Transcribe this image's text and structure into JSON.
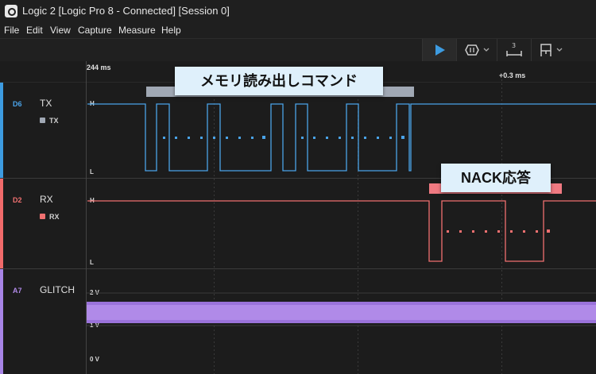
{
  "window": {
    "title": "Logic 2 [Logic Pro 8 - Connected] [Session 0]"
  },
  "menu": [
    "File",
    "Edit",
    "View",
    "Capture",
    "Measure",
    "Help"
  ],
  "ruler": {
    "start_label": "244 ms",
    "offset_label": "+0.3 ms"
  },
  "channels": {
    "tx": {
      "id": "D6",
      "name": "TX",
      "sublabel": "TX",
      "high": "H",
      "low": "L",
      "color": "#4aa3e8"
    },
    "rx": {
      "id": "D2",
      "name": "RX",
      "sublabel": "RX",
      "high": "H",
      "low": "L",
      "color": "#f07070"
    },
    "glitch": {
      "id": "A7",
      "name": "GLITCH",
      "v2": "2 V",
      "v1": "1 V",
      "v0": "0 V",
      "color": "#b08ae8"
    }
  },
  "annotations": {
    "tx_callout": "メモリ読み出しコマンド",
    "rx_callout": "NACK応答"
  },
  "colors": {
    "tx_tag": "#a0a8b4",
    "rx_tag": "#f07a82",
    "callout_bg": "#dff0fb",
    "play": "#3d9be0"
  },
  "icons": [
    "app-icon",
    "play-icon",
    "trigger-icon",
    "measure-icon",
    "marker-icon"
  ]
}
